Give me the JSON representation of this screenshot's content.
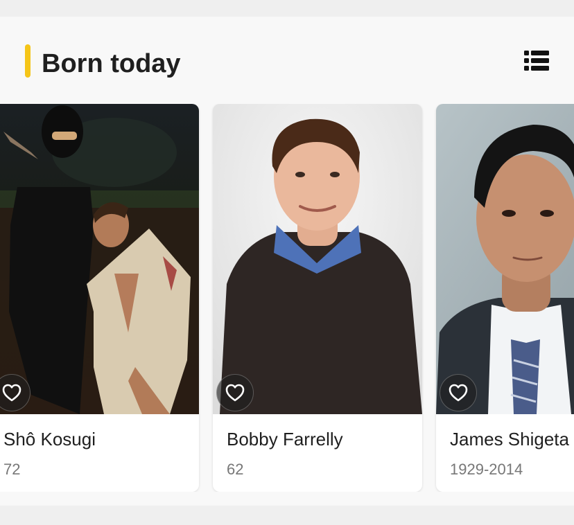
{
  "section": {
    "title": "Born today",
    "accent_color": "#f5c518",
    "header_icon": "list-view-icon"
  },
  "people": [
    {
      "name": "Shô Kosugi",
      "detail": "72",
      "favorite_icon": "heart-outline-icon"
    },
    {
      "name": "Bobby Farrelly",
      "detail": "62",
      "favorite_icon": "heart-outline-icon"
    },
    {
      "name": "James Shigeta",
      "detail": "1929-2014",
      "favorite_icon": "heart-outline-icon"
    }
  ]
}
